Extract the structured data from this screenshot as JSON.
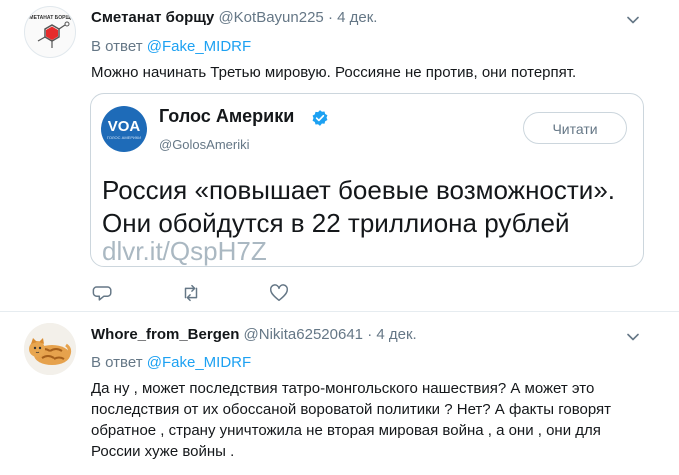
{
  "tweets": [
    {
      "name": "Сметанат борщу",
      "handle": "@KotBayun225",
      "separator": "·",
      "date": "4 дек.",
      "reply_prefix": "В ответ ",
      "reply_to": "@Fake_MIDRF",
      "text": "Можно начинать Третью мировую. Россияне не против, они потерпят.",
      "avatar_icon": "chemistry-logo-avatar",
      "avatar_text": "МЕТАНАТ БОРЩ"
    },
    {
      "name": "Whore_from_Bergen",
      "handle": "@Nikita62520641",
      "separator": "·",
      "date": "4 дек.",
      "reply_prefix": "В ответ ",
      "reply_to": "@Fake_MIDRF",
      "text": "Да ну , может последствия татро-монгольского нашествия? А может это последствия от их обоссаной вороватой политики ? Нет? А факты говорят обратное , страну уничтожила не вторая мировая война , а они , они для России хуже войны .",
      "avatar_icon": "cat-avatar"
    }
  ],
  "quote": {
    "logo_text": "VOA",
    "logo_subtext": "ГОЛОС АМЕРИКИ",
    "name": "Голос Америки",
    "handle": "@GolosAmeriki",
    "follow_label": "Читати",
    "body_line1": "Россия «повышает боевые возможности».",
    "body_line2": "Они обойдутся в 22 триллиона рублей",
    "link": "dlvr.it/QspH7Z",
    "verified_icon": "verified-badge-icon"
  },
  "actions": [
    "reply-icon",
    "retweet-icon",
    "like-icon"
  ],
  "colors": {
    "accent": "#1da1f2",
    "muted": "#657786",
    "text": "#14171a",
    "border": "#e6ecf0",
    "voa_blue": "#1e6bb8"
  }
}
